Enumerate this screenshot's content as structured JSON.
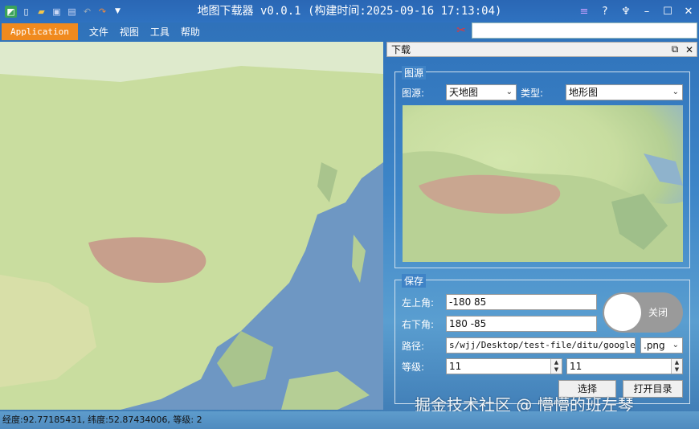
{
  "window": {
    "title": "地图下载器 v0.0.1 (构建时间:2025-09-16 17:13:04)"
  },
  "quick_access": [
    "map-app-icon",
    "new-file-icon",
    "open-folder-icon",
    "save-icon",
    "save-as-icon",
    "undo-icon",
    "redo-icon",
    "dropdown-icon"
  ],
  "window_controls": [
    "menu-icon",
    "help-icon",
    "skin-icon",
    "minimize-icon",
    "maximize-icon",
    "close-icon"
  ],
  "menubar": {
    "app_button": "Application",
    "items": [
      "文件",
      "视图",
      "工具",
      "帮助"
    ]
  },
  "download_panel": {
    "title": "下载",
    "source_group": {
      "legend": "图源",
      "source_label": "图源:",
      "source_value": "天地图",
      "type_label": "类型:",
      "type_value": "地形图"
    },
    "save_group": {
      "legend": "保存",
      "top_left_label": "左上角:",
      "top_left_value": "-180 85",
      "bottom_right_label": "右下角:",
      "bottom_right_value": "180 -85",
      "path_label": "路径:",
      "path_value": "s/wjj/Desktop/test-file/ditu/googlemap",
      "format_value": ".png",
      "level_label": "等级:",
      "level_min": "11",
      "level_max": "11",
      "select_button": "选择",
      "open_dir_button": "打开目录"
    },
    "toggle_label": "关闭"
  },
  "status": {
    "text": "经度:92.77185431, 纬度:52.87434006, 等级: 2"
  },
  "watermark": "掘金技术社区 @ 懵懵的班左琴",
  "colors": {
    "titlebar": "#2f72c0",
    "app_button": "#f08a1e",
    "land": "#c8dda0",
    "ocean": "#5a86bd"
  }
}
